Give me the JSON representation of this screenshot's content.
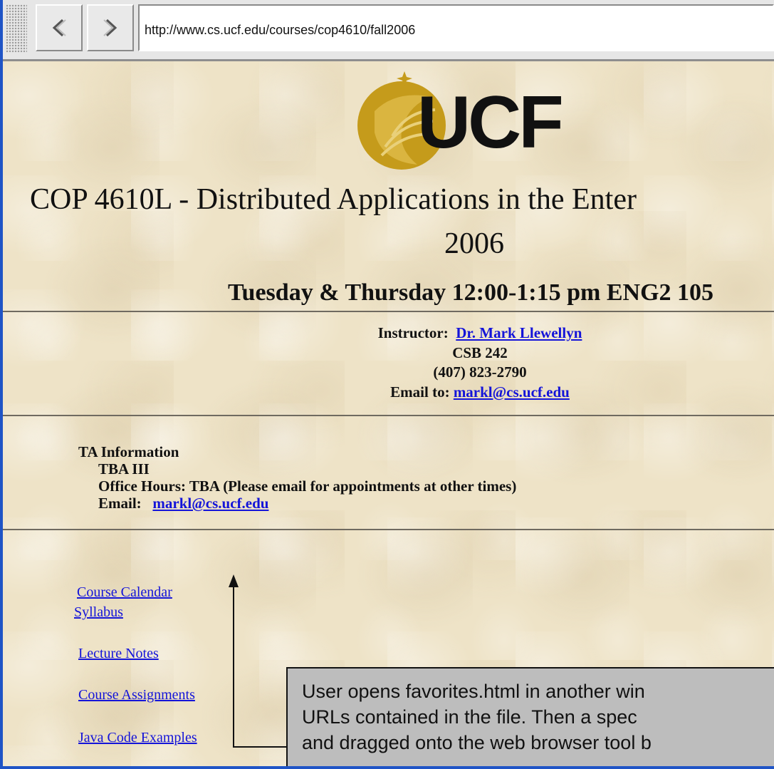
{
  "browser": {
    "url": "http://www.cs.ucf.edu/courses/cop4610/fall2006",
    "back_icon": "chevron-left-icon",
    "forward_icon": "chevron-right-icon"
  },
  "page": {
    "logo_text": "UCF",
    "logo_color": "#c59b1b",
    "title_line1": "COP 4610L - Distributed Applications in the Enter",
    "title_line2": "2006",
    "schedule": "Tuesday & Thursday 12:00-1:15 pm ENG2 105",
    "instructor": {
      "label": "Instructor:",
      "name": "Dr. Mark Llewellyn",
      "office": "CSB 242",
      "phone": "(407) 823-2790",
      "email_label": "Email to:",
      "email": "markl@cs.ucf.edu"
    },
    "ta": {
      "heading": "TA Information",
      "name": "TBA III",
      "office_hours": "Office Hours:   TBA  (Please email for appointments at other times)",
      "email_label": "Email:",
      "email": "markl@cs.ucf.edu"
    },
    "links": [
      "Course Calendar",
      "Syllabus",
      "Lecture Notes",
      "Course Assignments",
      "Java Code Examples"
    ]
  },
  "callout": {
    "line1": "User opens favorites.html in another win",
    "line2": "URLs contained in the file.  Then a spec",
    "line3": "and dragged onto the web browser tool b"
  },
  "colors": {
    "link": "#1414d9",
    "frame": "#1f54c6",
    "callout_bg": "#bdbdbd"
  }
}
